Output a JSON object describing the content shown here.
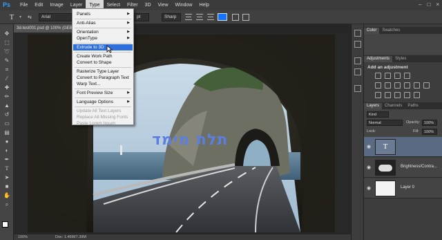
{
  "menubar": {
    "logo": "Ps",
    "items": [
      "File",
      "Edit",
      "Image",
      "Layer",
      "Type",
      "Select",
      "Filter",
      "3D",
      "View",
      "Window",
      "Help"
    ],
    "active": "Type"
  },
  "options": {
    "font_family": "Arial",
    "font_size": "pt",
    "anti_alias": "Sharp",
    "color": "#1673ff"
  },
  "document": {
    "tab_title": "3d-test001.psd @ 100% (GEBO",
    "zoom": "100%",
    "doc_size": "Doc: 1.46M/7.39M",
    "overlay_text": "תלת מימד"
  },
  "type_menu": {
    "items": [
      {
        "label": "Panels",
        "submenu": true
      },
      {
        "label": "Anti-Alias",
        "submenu": true
      },
      {
        "label": "Orientation",
        "submenu": true
      },
      {
        "label": "OpenType",
        "submenu": true
      },
      {
        "label": "Extrude to 3D",
        "highlight": true
      },
      {
        "label": "Create Work Path"
      },
      {
        "label": "Convert to Shape"
      },
      {
        "label": "Rasterize Type Layer"
      },
      {
        "label": "Convert to Paragraph Text"
      },
      {
        "label": "Warp Text..."
      },
      {
        "label": "Font Preview Size",
        "submenu": true
      },
      {
        "label": "Language Options",
        "submenu": true
      },
      {
        "label": "Update All Text Layers",
        "disabled": true
      },
      {
        "label": "Replace All Missing Fonts",
        "disabled": true
      },
      {
        "label": "Paste Lorem Ipsum",
        "disabled": true
      }
    ]
  },
  "panels": {
    "color_tabs": [
      "Color",
      "Swatches"
    ],
    "adjust_tabs": [
      "Adjustments",
      "Styles"
    ],
    "adjust_title": "Add an adjustment",
    "layer_tabs": [
      "Layers",
      "Channels",
      "Paths"
    ],
    "kind_label": "Kind",
    "blend_mode": "Normal",
    "opacity_label": "Opacity:",
    "opacity": "100%",
    "lock_label": "Lock:",
    "fill_label": "Fill:",
    "fill": "100%",
    "layers": [
      {
        "name": "",
        "type": "text",
        "selected": true
      },
      {
        "name": "Brightness/Contra...",
        "type": "adjustment"
      },
      {
        "name": "Layer 0",
        "type": "pixel"
      }
    ]
  }
}
